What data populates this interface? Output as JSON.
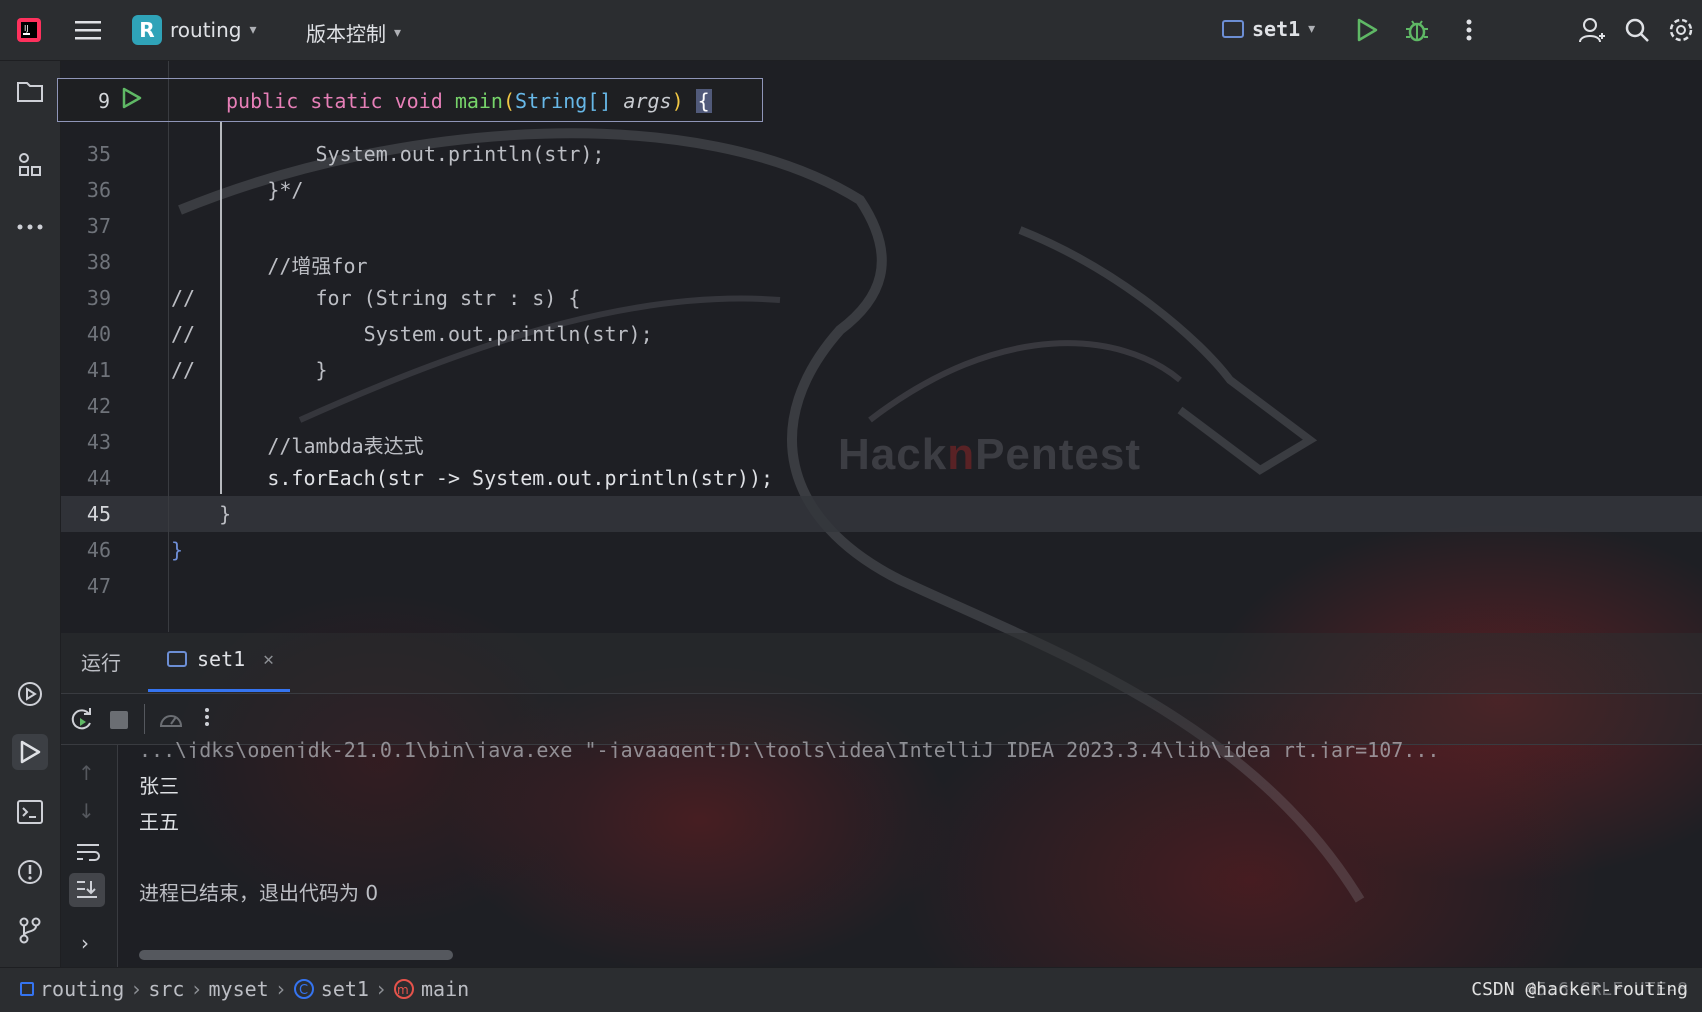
{
  "topbar": {
    "project_badge": "R",
    "project_name": "routing",
    "vcs_menu": "版本控制",
    "run_config": "set1"
  },
  "sticky_header": {
    "line": "9",
    "code_public": "public",
    "code_static": "static",
    "code_void": "void",
    "code_main": "main",
    "code_type": "String[]",
    "code_args": "args",
    "code_brace": "{"
  },
  "editor": {
    "lines": [
      {
        "n": "35",
        "text": "            System.out.println(str);"
      },
      {
        "n": "36",
        "text": "        }*/"
      },
      {
        "n": "37",
        "text": ""
      },
      {
        "n": "38",
        "text": "        //增强for"
      },
      {
        "n": "39",
        "text": "//          for (String str : s) {"
      },
      {
        "n": "40",
        "text": "//              System.out.println(str);"
      },
      {
        "n": "41",
        "text": "//          }"
      },
      {
        "n": "42",
        "text": ""
      },
      {
        "n": "43",
        "text": "        //lambda表达式"
      },
      {
        "n": "44",
        "text": "        s.forEach(str -> System.out.println(str));"
      },
      {
        "n": "45",
        "text": "    }"
      },
      {
        "n": "46",
        "text": "}"
      },
      {
        "n": "47",
        "text": ""
      }
    ],
    "current_line": "45"
  },
  "toolwindow": {
    "tab_run": "运行",
    "tab_config": "set1",
    "command_line": "...\\jdks\\openjdk-21.0.1\\bin\\java.exe \"-javaagent:D:\\tools\\idea\\IntelliJ IDEA 2023.3.4\\lib\\idea_rt.jar=107...",
    "output": [
      "张三",
      "王五",
      "",
      "进程已结束，退出代码为 0"
    ]
  },
  "statusbar": {
    "crumbs": [
      "routing",
      "src",
      "myset",
      "set1",
      "main"
    ],
    "right": "45:6  CRLF  UTF-8",
    "watermark": "CSDN @hacker-routing"
  },
  "wallpaper": {
    "logo_text_a": "Hack",
    "logo_text_b": "n",
    "logo_text_c": "Pentest"
  },
  "colors": {
    "accent": "#3574f0",
    "run_green": "#5fb865",
    "keyword_pink": "#e67fb7",
    "function_green": "#77d46a"
  }
}
